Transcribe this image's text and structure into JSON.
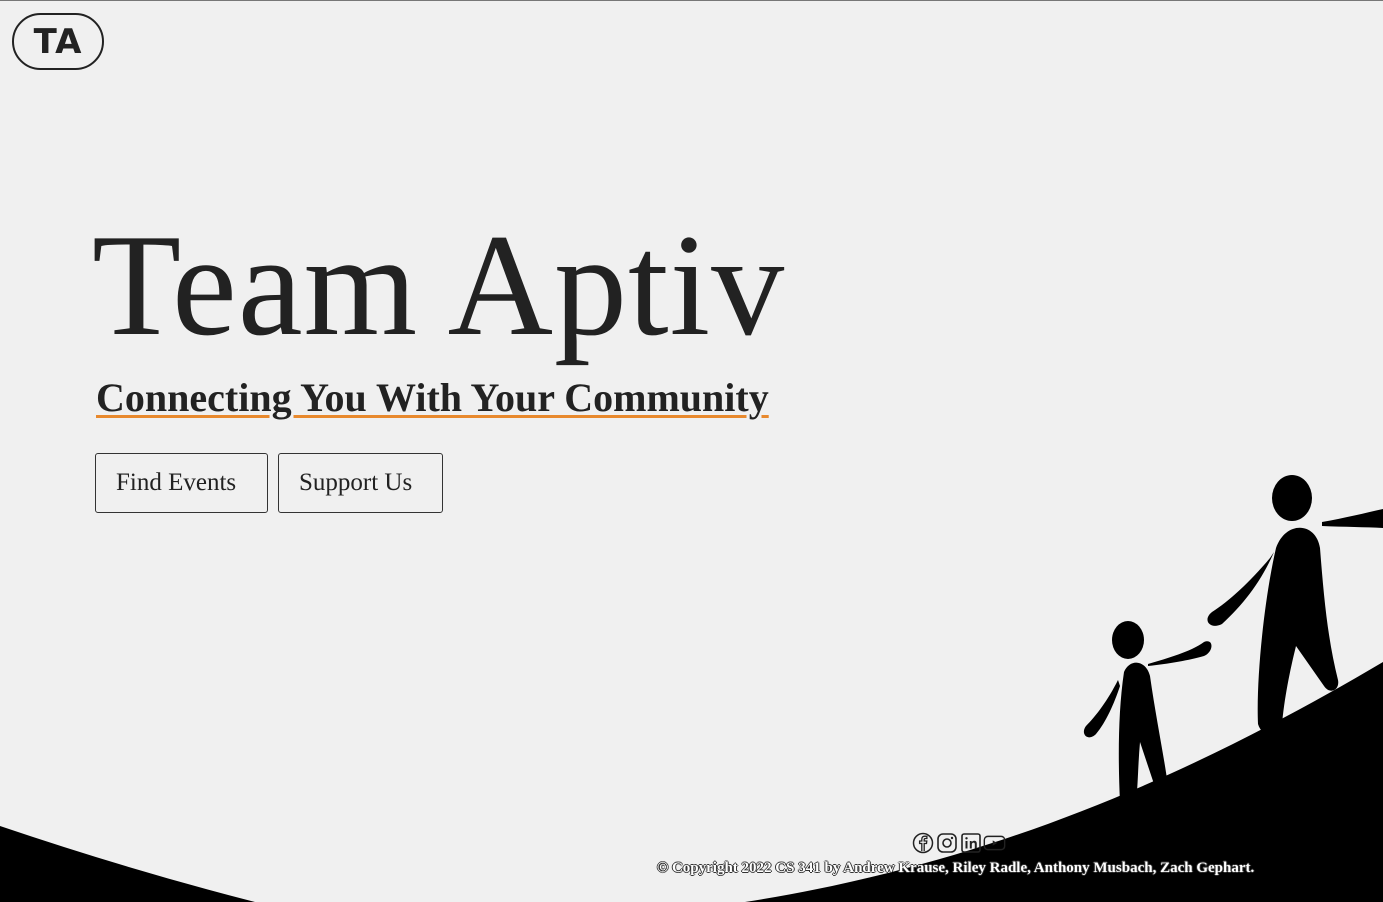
{
  "header": {
    "logo_text": "TA"
  },
  "hero": {
    "title": "Team Aptiv",
    "subtitle": "Connecting You With Your Community",
    "buttons": {
      "find_events": "Find Events",
      "support_us": "Support Us"
    }
  },
  "footer": {
    "social_icons": [
      "facebook-icon",
      "instagram-icon",
      "linkedin-icon",
      "youtube-icon"
    ],
    "copyright": "© Copyright 2022 CS 341 by Andrew Krause, Riley Radle, Anthony Musbach, Zach Gephart."
  },
  "colors": {
    "background": "#f0f0f0",
    "text": "#222222",
    "accent_underline": "#e8892d",
    "hill": "#000000"
  }
}
